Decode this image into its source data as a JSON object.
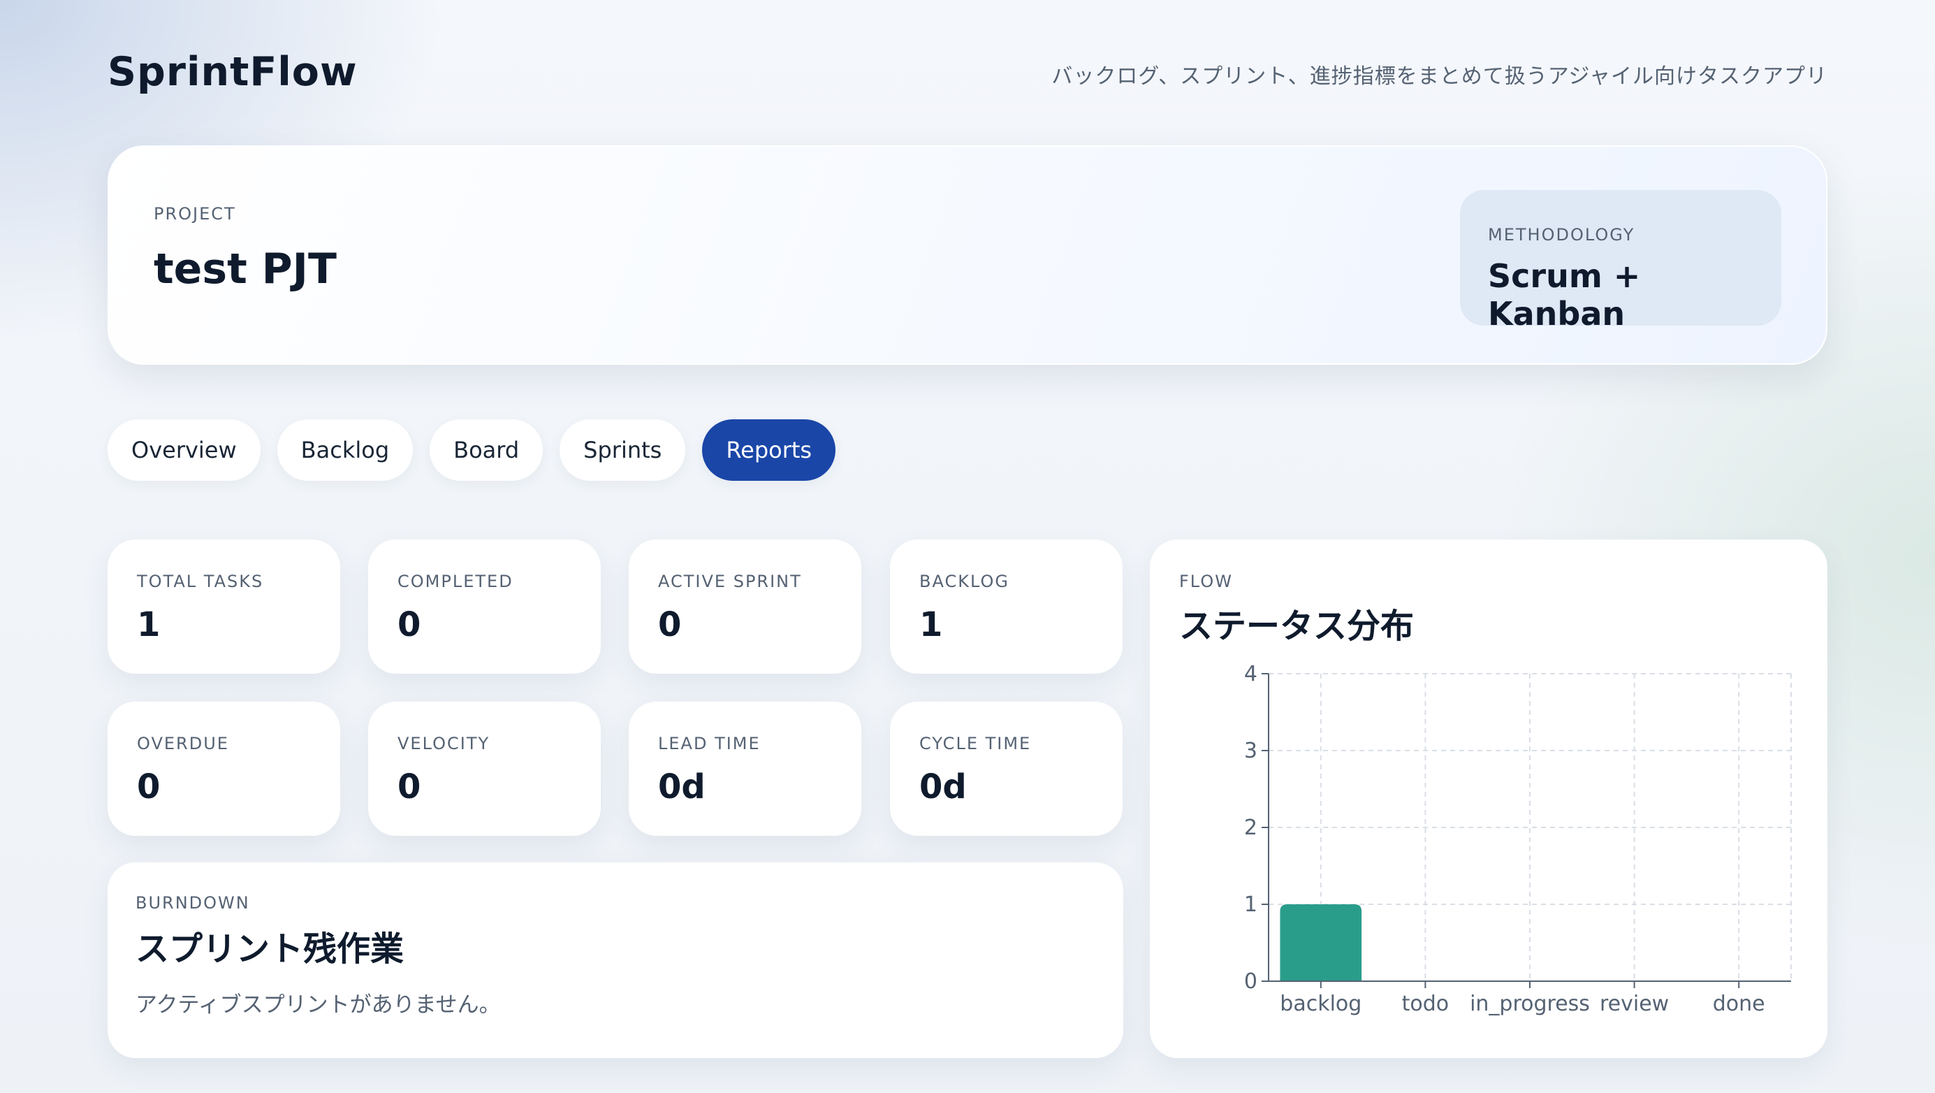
{
  "app": {
    "brand": "SprintFlow",
    "tagline": "バックログ、スプリント、進捗指標をまとめて扱うアジャイル向けタスクアプリ"
  },
  "project": {
    "label": "PROJECT",
    "name": "test PJT",
    "methodology_label": "METHODOLOGY",
    "methodology_value": "Scrum + Kanban"
  },
  "tabs": [
    {
      "label": "Overview",
      "active": false
    },
    {
      "label": "Backlog",
      "active": false
    },
    {
      "label": "Board",
      "active": false
    },
    {
      "label": "Sprints",
      "active": false
    },
    {
      "label": "Reports",
      "active": true
    }
  ],
  "stats": [
    {
      "label": "TOTAL TASKS",
      "value": "1"
    },
    {
      "label": "COMPLETED",
      "value": "0"
    },
    {
      "label": "ACTIVE SPRINT",
      "value": "0"
    },
    {
      "label": "BACKLOG",
      "value": "1"
    },
    {
      "label": "OVERDUE",
      "value": "0"
    },
    {
      "label": "VELOCITY",
      "value": "0"
    },
    {
      "label": "LEAD TIME",
      "value": "0d"
    },
    {
      "label": "CYCLE TIME",
      "value": "0d"
    }
  ],
  "burndown": {
    "kicker": "BURNDOWN",
    "title": "スプリント残作業",
    "note": "アクティブスプリントがありません。"
  },
  "flow": {
    "kicker": "FLOW",
    "title": "ステータス分布"
  },
  "colors": {
    "accent": "#1a46a8",
    "bar": "#2a9d8a",
    "text": "#0f1b2d",
    "muted": "#556273"
  },
  "chart_data": {
    "type": "bar",
    "categories": [
      "backlog",
      "todo",
      "in_progress",
      "review",
      "done"
    ],
    "values": [
      1,
      0,
      0,
      0,
      0
    ],
    "ylim": [
      0,
      4
    ],
    "yticks": [
      0,
      1,
      2,
      3,
      4
    ],
    "grid": true,
    "title": "",
    "xlabel": "",
    "ylabel": ""
  }
}
